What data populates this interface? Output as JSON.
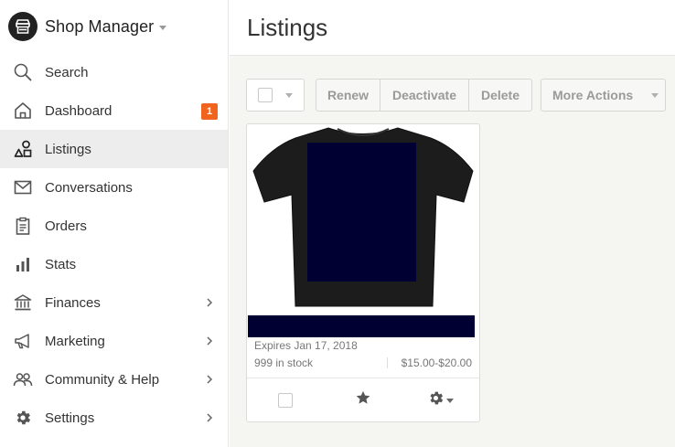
{
  "colors": {
    "accent_badge": "#f1641e",
    "sidebar_active": "#ededed",
    "main_background": "#f5f5f1",
    "redaction": "#000033"
  },
  "sidebar": {
    "shop_name": "Shop Manager",
    "items": [
      {
        "label": "Search",
        "icon": "search-icon"
      },
      {
        "label": "Dashboard",
        "icon": "home-icon",
        "badge": "1"
      },
      {
        "label": "Listings",
        "icon": "listings-icon",
        "active": true
      },
      {
        "label": "Conversations",
        "icon": "mail-icon"
      },
      {
        "label": "Orders",
        "icon": "clipboard-icon"
      },
      {
        "label": "Stats",
        "icon": "bar-chart-icon"
      },
      {
        "label": "Finances",
        "icon": "bank-icon",
        "chevron": true
      },
      {
        "label": "Marketing",
        "icon": "megaphone-icon",
        "chevron": true
      },
      {
        "label": "Community & Help",
        "icon": "people-icon",
        "chevron": true
      },
      {
        "label": "Settings",
        "icon": "gear-icon",
        "chevron": true
      }
    ]
  },
  "main": {
    "title": "Listings",
    "toolbar": {
      "renew_label": "Renew",
      "deactivate_label": "Deactivate",
      "delete_label": "Delete",
      "more_actions_label": "More Actions"
    },
    "listing": {
      "image": "black-tshirt-image",
      "expires": "Expires Jan 17, 2018",
      "stock": "999 in stock",
      "price": "$15.00-$20.00"
    }
  }
}
